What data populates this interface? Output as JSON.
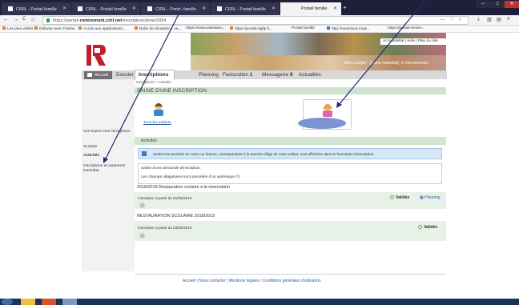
{
  "browser": {
    "tabs": [
      {
        "label": "CIRIL - Portail famille"
      },
      {
        "label": "CIRIL - Portail famille"
      },
      {
        "label": "CIRIL - Portail famille"
      },
      {
        "label": "CIRIL - Portail famille"
      },
      {
        "label": "Portail famille"
      }
    ],
    "new_tab": "+",
    "url": "https://portail-remiremont.ciril.net/inscription/show/2054",
    "url_prefix": "https://portail-",
    "url_domain": "remiremont.ciril.net",
    "url_path": "/inscription/show/2054",
    "nav": {
      "back": "←",
      "forward": "→",
      "reload": "C",
      "home": "⌂",
      "menu": "⋯",
      "shield": "♡",
      "star": "☆"
    },
    "bookmarks": [
      "Les plus visités",
      "Débuter avec Firefox",
      "Accès aux applications...",
      "Boîte de réception - va...",
      "https://www.assistanc...",
      "https://portail-dgfip.fi...",
      "Portail famille",
      "http://nextcloud.mairi...",
      "https://portail-remire..."
    ]
  },
  "site": {
    "accessibility": "Accessibilité",
    "help": "Aide",
    "sitemap": "Plan du site",
    "account": "Mon compte : [name redacted]",
    "logout": "Déconnexion",
    "menu": {
      "home": "Accueil",
      "dossier": "Dossier",
      "inscriptions": "Inscriptions",
      "planning": "Planning",
      "facturation": "Facturation",
      "facturation_count": "1",
      "messagerie": "Messagerie",
      "messagerie_count": "9",
      "actualites": "Actualités"
    },
    "breadcrumb": "Inscriptions > Activités",
    "sidebar": [
      "Voir toutes mes inscriptions",
      "Scolaire",
      "Activités",
      "Inscriptions en paiement immédiat"
    ],
    "page_title": "SAISIE D'UNE INSCRIPTION",
    "all_children": "Tous les enfants",
    "child_name": "",
    "section": "Activités",
    "info": "Seules les activités en cours ou futures, correspondant à la tranche d'âge de votre enfant, sont affichées dans le formulaire d'inscription.",
    "form_title": "Saisie d'une demande d'inscription",
    "form_note": "Les champs obligatoires sont précédés d'un astérisque (*).",
    "groups": [
      {
        "title": "2018/2019 Restauration scolaire à la réservation",
        "line": "Inscription à partir du 01/05/2019",
        "status": "Validée",
        "planning": "Planning"
      },
      {
        "title": "RESTAURATION SCOLAIRE 2018/2019",
        "line": "Inscription à partir du 03/09/2018",
        "status": "Validée"
      }
    ],
    "footer": {
      "home": "Accueil",
      "contact": "Nous contacter",
      "legal": "Mentions légales",
      "terms": "Conditions générales d'utilisation"
    }
  },
  "colors": {
    "logo_red": "#c0202a",
    "link_blue": "#2860a8",
    "valid_green": "#6bb04b",
    "title_green": "#cfe4cf",
    "annotation": "#1f2a7a"
  }
}
